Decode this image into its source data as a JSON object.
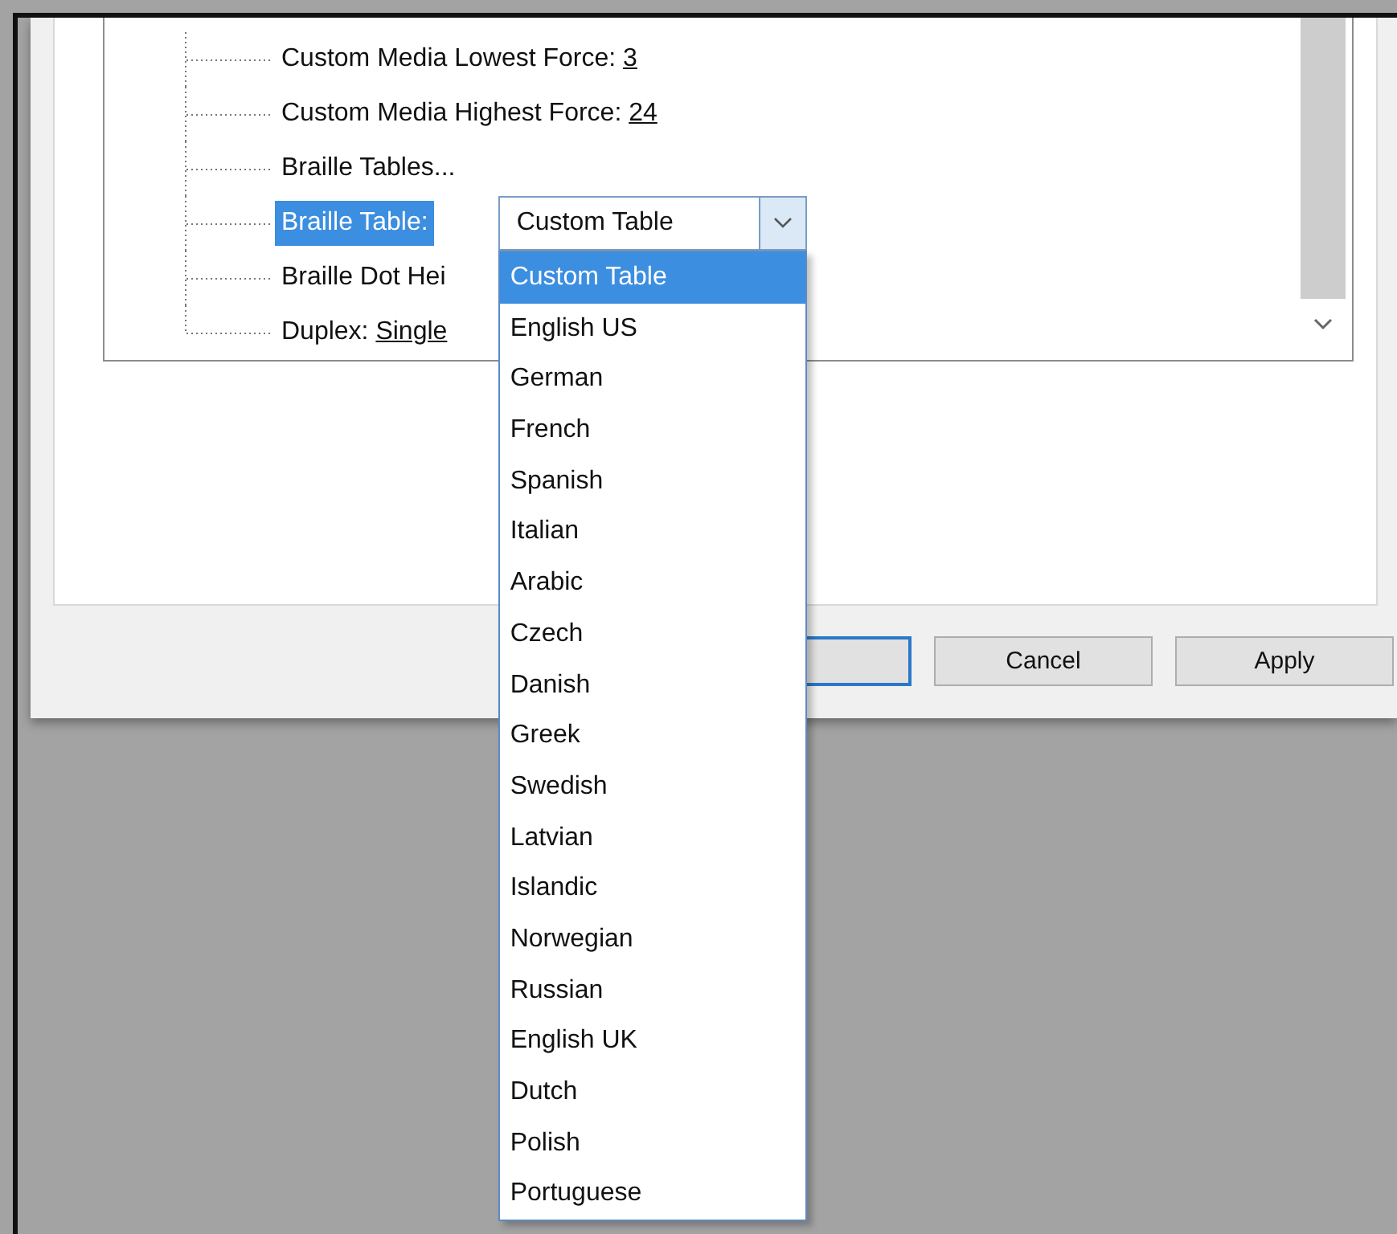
{
  "tree": {
    "items": [
      {
        "label": "Custom Media Lowest Force:",
        "value": "3",
        "selected": false
      },
      {
        "label": "Custom Media Highest Force:",
        "value": "24",
        "selected": false
      },
      {
        "label": "Braille Tables...",
        "selected": false
      },
      {
        "label": "Braille Table:",
        "selected": true,
        "combo": {
          "value": "Custom Table"
        }
      },
      {
        "label": "Braille Dot Hei",
        "selected": false
      },
      {
        "label": "Duplex:",
        "value": "Single",
        "selected": false
      }
    ]
  },
  "dropdown": {
    "options": [
      {
        "label": "Custom Table",
        "selected": true
      },
      {
        "label": "English US",
        "selected": false
      },
      {
        "label": "German",
        "selected": false
      },
      {
        "label": "French",
        "selected": false
      },
      {
        "label": "Spanish",
        "selected": false
      },
      {
        "label": "Italian",
        "selected": false
      },
      {
        "label": "Arabic",
        "selected": false
      },
      {
        "label": "Czech",
        "selected": false
      },
      {
        "label": "Danish",
        "selected": false
      },
      {
        "label": "Greek",
        "selected": false
      },
      {
        "label": "Swedish",
        "selected": false
      },
      {
        "label": "Latvian",
        "selected": false
      },
      {
        "label": "Islandic",
        "selected": false
      },
      {
        "label": "Norwegian",
        "selected": false
      },
      {
        "label": "Russian",
        "selected": false
      },
      {
        "label": "English UK",
        "selected": false
      },
      {
        "label": "Dutch",
        "selected": false
      },
      {
        "label": "Polish",
        "selected": false
      },
      {
        "label": "Portuguese",
        "selected": false
      }
    ]
  },
  "buttons": [
    {
      "label": "Cancel"
    },
    {
      "label": "Apply"
    }
  ]
}
